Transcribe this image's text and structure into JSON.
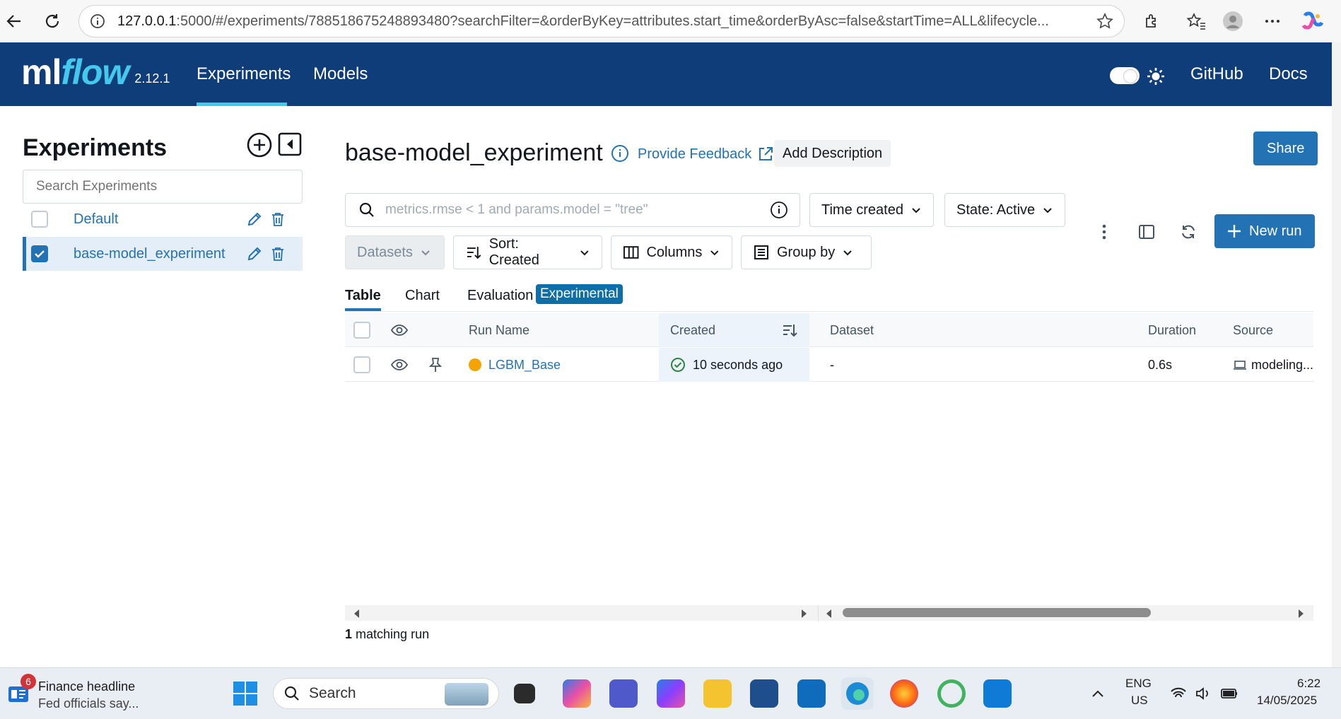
{
  "browser": {
    "url_host": "127.0.0.1",
    "url_rest": ":5000/#/experiments/788518675248893480?searchFilter=&orderByKey=attributes.start_time&orderByAsc=false&startTime=ALL&lifecycle..."
  },
  "header": {
    "logo_ml": "ml",
    "logo_flow": "flow",
    "version": "2.12.1",
    "nav": [
      "Experiments",
      "Models"
    ],
    "github": "GitHub",
    "docs": "Docs"
  },
  "sidebar": {
    "title": "Experiments",
    "search_placeholder": "Search Experiments",
    "items": [
      {
        "name": "Default",
        "checked": false
      },
      {
        "name": "base-model_experiment",
        "checked": true
      }
    ]
  },
  "main": {
    "title": "base-model_experiment",
    "feedback": "Provide Feedback",
    "add_description": "Add Description",
    "share": "Share",
    "search_placeholder": "metrics.rmse < 1 and params.model = \"tree\"",
    "time_created": "Time created",
    "state": "State: Active",
    "new_run": "New run",
    "datasets": "Datasets",
    "sort": "Sort: Created",
    "columns": "Columns",
    "group_by": "Group by",
    "tabs": [
      "Table",
      "Chart",
      "Evaluation"
    ],
    "experimental_badge": "Experimental",
    "table": {
      "headers": {
        "run_name": "Run Name",
        "created": "Created",
        "dataset": "Dataset",
        "duration": "Duration",
        "source": "Source"
      },
      "rows": [
        {
          "run_name": "LGBM_Base",
          "created": "10 seconds ago",
          "dataset": "-",
          "duration": "0.6s",
          "source": "modeling..."
        }
      ]
    },
    "match_count_num": "1",
    "match_count_text": "matching run"
  },
  "taskbar": {
    "news_badge": "6",
    "news_title": "Finance headline",
    "news_sub": "Fed officials say...",
    "search": "Search",
    "lang": "ENG",
    "region": "US",
    "time": "6:22",
    "date": "14/05/2025"
  },
  "colors": {
    "header_bg": "#0e3d7a",
    "accent": "#2272b4",
    "logo_flow": "#43c9ed",
    "run_dot": "#f5a300",
    "success": "#2e8540"
  }
}
